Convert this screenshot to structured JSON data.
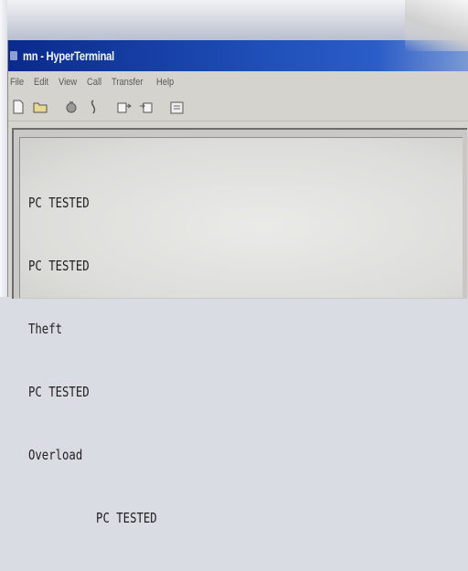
{
  "window": {
    "title": "mn - HyperTerminal"
  },
  "menubar": {
    "items": [
      {
        "label": "File"
      },
      {
        "label": "Edit"
      },
      {
        "label": "View"
      },
      {
        "label": "Call"
      },
      {
        "label": "Transfer"
      },
      {
        "label": "Help"
      }
    ]
  },
  "toolbar": {
    "buttons": [
      {
        "icon": "new-document-icon"
      },
      {
        "icon": "open-folder-icon"
      },
      {
        "icon": "connect-icon"
      },
      {
        "icon": "disconnect-icon"
      },
      {
        "icon": "send-icon"
      },
      {
        "icon": "receive-icon"
      },
      {
        "icon": "properties-icon"
      }
    ]
  },
  "terminal": {
    "lines": [
      "PC TESTED",
      "PC TESTED",
      "Theft",
      "PC TESTED",
      "Overload",
      "          PC TESTED"
    ]
  }
}
